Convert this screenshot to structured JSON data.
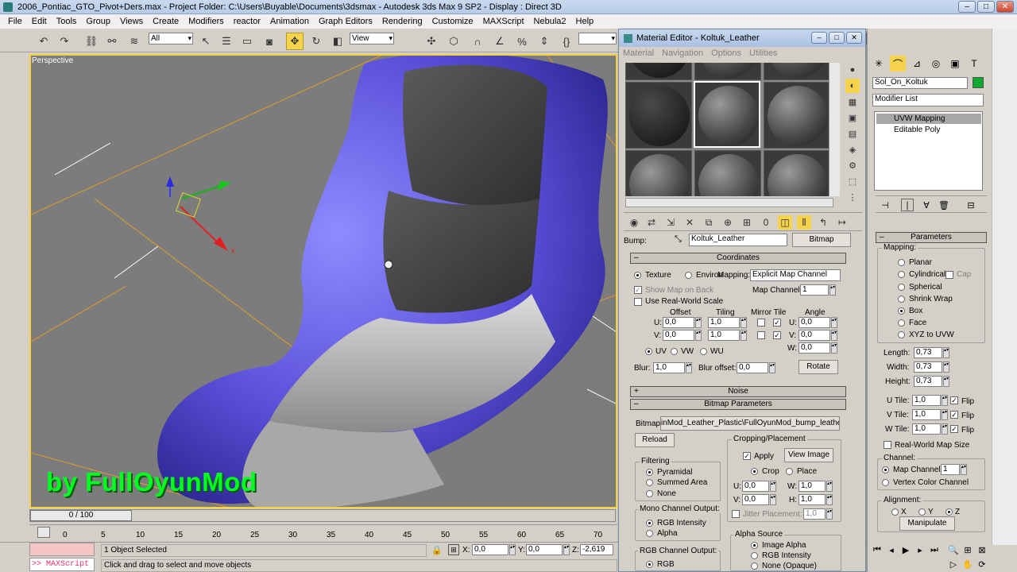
{
  "window": {
    "title": "2006_Pontiac_GTO_Pivot+Ders.max    - Project Folder: C:\\Users\\Buyable\\Documents\\3dsmax    - Autodesk 3ds Max 9 SP2    - Display : Direct 3D"
  },
  "menu": [
    "File",
    "Edit",
    "Tools",
    "Group",
    "Views",
    "Create",
    "Modifiers",
    "reactor",
    "Animation",
    "Graph Editors",
    "Rendering",
    "Customize",
    "MAXScript",
    "Nebula2",
    "Help"
  ],
  "toolbar": {
    "selection_filter": "All",
    "ref_coord": "View"
  },
  "viewport": {
    "label": "Perspective",
    "watermark": "by FullOyunMod",
    "axis_x": "x"
  },
  "timeline": {
    "slider": "0 / 100",
    "ticks": [
      "0",
      "5",
      "10",
      "15",
      "20",
      "25",
      "30",
      "35",
      "40",
      "45",
      "50",
      "55",
      "60",
      "65",
      "70"
    ]
  },
  "status": {
    "selected": "1 Object Selected",
    "prompt": "Click and drag to select and move objects",
    "maxscript": ">> MAXScript",
    "x_label": "X:",
    "x": "0,0",
    "y_label": "Y:",
    "y": "0,0",
    "z_label": "Z:",
    "z": "-2,619"
  },
  "material_editor": {
    "title": "Material Editor - Koltuk_Leather",
    "menu": [
      "Material",
      "Navigation",
      "Options",
      "Utilities"
    ],
    "bump_label": "Bump:",
    "map_name": "Koltuk_Leather",
    "map_type": "Bitmap",
    "coordinates": {
      "header": "Coordinates",
      "texture": "Texture",
      "environ": "Environ",
      "mapping_label": "Mapping:",
      "mapping": "Explicit Map Channel",
      "show_map": "Show Map on Back",
      "map_channel_label": "Map Channel:",
      "map_channel": "1",
      "real_world": "Use Real-World Scale",
      "offset": "Offset",
      "tiling": "Tiling",
      "mirror_tile": "Mirror Tile",
      "angle": "Angle",
      "u_label": "U:",
      "v_label": "V:",
      "w_label": "W:",
      "u_offset": "0,0",
      "v_offset": "0,0",
      "u_tiling": "1,0",
      "v_tiling": "1,0",
      "u_angle": "0,0",
      "v_angle": "0,0",
      "w_angle": "0,0",
      "uv": "UV",
      "vw": "VW",
      "wu": "WU",
      "blur_label": "Blur:",
      "blur": "1,0",
      "blur_offset_label": "Blur offset:",
      "blur_offset": "0,0",
      "rotate": "Rotate"
    },
    "noise_header": "Noise",
    "bitmap_params": {
      "header": "Bitmap Parameters",
      "bitmap_label": "Bitmap:",
      "bitmap_path": "inMod_Leather_Plastic\\FullOyunMod_bump_leather.dds",
      "reload": "Reload",
      "cropping": "Cropping/Placement",
      "apply": "Apply",
      "view_image": "View Image",
      "crop": "Crop",
      "place": "Place",
      "cu_label": "U:",
      "cu": "0,0",
      "cw_label": "W:",
      "cw": "1,0",
      "cv_label": "V:",
      "cv": "0,0",
      "ch_label": "H:",
      "ch": "1,0",
      "jitter": "Jitter Placement:",
      "jitter_val": "1,0",
      "filtering": "Filtering",
      "pyramidal": "Pyramidal",
      "summed": "Summed Area",
      "none": "None",
      "mono": "Mono Channel Output:",
      "rgb_intensity": "RGB Intensity",
      "alpha": "Alpha",
      "rgb_out": "RGB Channel Output:",
      "rgb": "RGB",
      "alpha_source": "Alpha Source",
      "image_alpha": "Image Alpha",
      "rgb_int2": "RGB Intensity",
      "none_opaque": "None (Opaque)"
    }
  },
  "command_panel": {
    "object_name": "Sol_On_Koltuk",
    "object_color": "#0fa830",
    "modifier_list": "Modifier List",
    "stack": [
      "UVW Mapping",
      "Editable Poly"
    ],
    "params_header": "Parameters",
    "mapping_label": "Mapping:",
    "types": [
      "Planar",
      "Cylindrical",
      "Spherical",
      "Shrink Wrap",
      "Box",
      "Face",
      "XYZ to UVW"
    ],
    "cap": "Cap",
    "length_label": "Length:",
    "length": "0,73",
    "width_label": "Width:",
    "width": "0,73",
    "height_label": "Height:",
    "height": "0,73",
    "utile_label": "U Tile:",
    "utile": "1,0",
    "vtile_label": "V Tile:",
    "vtile": "1,0",
    "wtile_label": "W Tile:",
    "wtile": "1,0",
    "flip": "Flip",
    "real_world": "Real-World Map Size",
    "channel_label": "Channel:",
    "map_channel": "Map Channel:",
    "map_channel_val": "1",
    "vertex_color": "Vertex Color Channel",
    "alignment": "Alignment:",
    "ax": "X",
    "ay": "Y",
    "az": "Z",
    "manipulate": "Manipulate"
  }
}
